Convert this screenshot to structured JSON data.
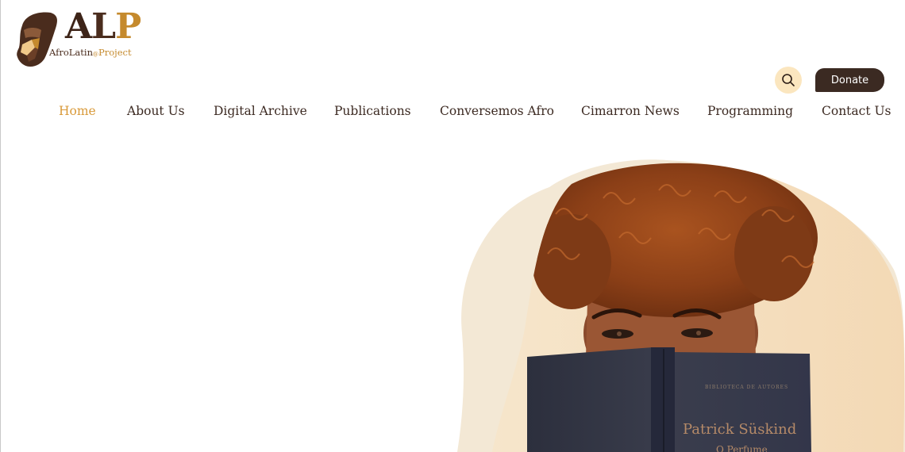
{
  "logo": {
    "letters_a": "A",
    "letters_l": "L",
    "letters_p": "P",
    "sub_main": "AfroLatin",
    "sub_at": "@",
    "sub_project": "Project"
  },
  "header": {
    "search_icon": "search-icon",
    "donate_label": "Donate"
  },
  "nav": {
    "items": [
      {
        "label": "Home",
        "active": true
      },
      {
        "label": "About Us"
      },
      {
        "label": "Digital Archive"
      },
      {
        "label": "Publications"
      },
      {
        "label": "Conversemos Afro"
      },
      {
        "label": "Cimarron News"
      },
      {
        "label": "Programming"
      },
      {
        "label": "Contact Us"
      }
    ]
  },
  "hero": {
    "book_title": "Patrick Süskind",
    "book_subtitle": "O Perfume",
    "book_publisher": "BIBLIOTECA DE AUTORES"
  },
  "colors": {
    "brand_dark": "#3b2a22",
    "brand_gold": "#c58a2d",
    "nav_active": "#d99a3a",
    "search_bg": "#fbe6bf",
    "blob_bg": "#f3e8d5"
  }
}
